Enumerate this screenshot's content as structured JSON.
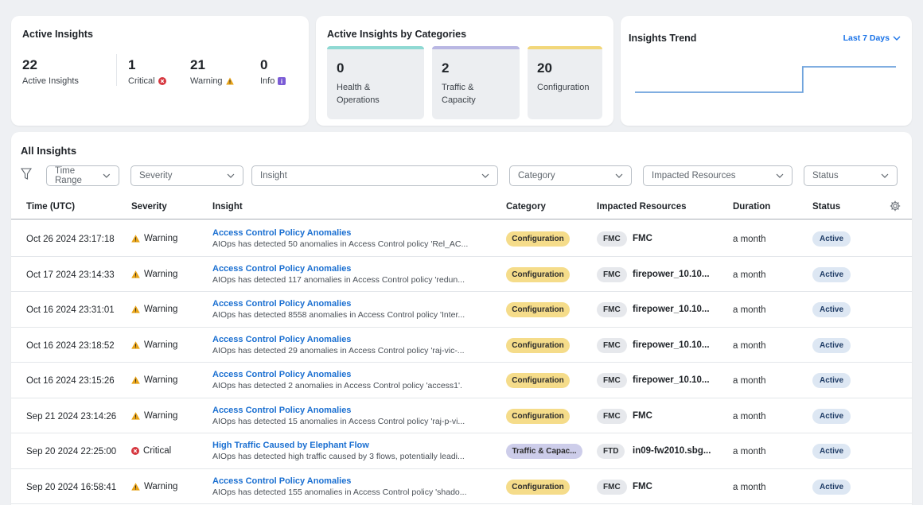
{
  "active_insights": {
    "title": "Active Insights",
    "total": {
      "value": "22",
      "label": "Active Insights"
    },
    "critical": {
      "value": "1",
      "label": "Critical"
    },
    "warning": {
      "value": "21",
      "label": "Warning"
    },
    "info": {
      "value": "0",
      "label": "Info"
    }
  },
  "categories_card": {
    "title": "Active Insights by Categories",
    "items": [
      {
        "value": "0",
        "label": "Health & Operations",
        "color": "#8fd9d3"
      },
      {
        "value": "2",
        "label": "Traffic & Capacity",
        "color": "#b9b7e3"
      },
      {
        "value": "20",
        "label": "Configuration",
        "color": "#f2d77a"
      }
    ]
  },
  "trend_card": {
    "title": "Insights Trend",
    "range_label": "Last 7 Days",
    "line_color": "#6fa3dd",
    "step_values": [
      1,
      1,
      1,
      1,
      1,
      2,
      2,
      2
    ]
  },
  "all_insights": {
    "title": "All Insights",
    "filters": {
      "time_range": "Time Range",
      "severity": "Severity",
      "insight": "Insight",
      "category": "Category",
      "impacted_resources": "Impacted Resources",
      "status": "Status"
    },
    "columns": {
      "time": "Time (UTC)",
      "severity": "Severity",
      "insight": "Insight",
      "category": "Category",
      "impacted_resources": "Impacted Resources",
      "duration": "Duration",
      "status": "Status"
    },
    "rows": [
      {
        "time": "Oct 26 2024 23:17:18",
        "severity": "Warning",
        "title": "Access Control Policy Anomalies",
        "desc": "AIOps has detected 50 anomalies in Access Control policy 'Rel_AC...",
        "category": "Configuration",
        "res_type": "FMC",
        "resource": "FMC",
        "duration": "a month",
        "status": "Active"
      },
      {
        "time": "Oct 17 2024 23:14:33",
        "severity": "Warning",
        "title": "Access Control Policy Anomalies",
        "desc": "AIOps has detected 117 anomalies in Access Control policy 'redun...",
        "category": "Configuration",
        "res_type": "FMC",
        "resource": "firepower_10.10...",
        "duration": "a month",
        "status": "Active"
      },
      {
        "time": "Oct 16 2024 23:31:01",
        "severity": "Warning",
        "title": "Access Control Policy Anomalies",
        "desc": "AIOps has detected 8558 anomalies in Access Control policy 'Inter...",
        "category": "Configuration",
        "res_type": "FMC",
        "resource": "firepower_10.10...",
        "duration": "a month",
        "status": "Active"
      },
      {
        "time": "Oct 16 2024 23:18:52",
        "severity": "Warning",
        "title": "Access Control Policy Anomalies",
        "desc": "AIOps has detected 29 anomalies in Access Control policy 'raj-vic-...",
        "category": "Configuration",
        "res_type": "FMC",
        "resource": "firepower_10.10...",
        "duration": "a month",
        "status": "Active"
      },
      {
        "time": "Oct 16 2024 23:15:26",
        "severity": "Warning",
        "title": "Access Control Policy Anomalies",
        "desc": "AIOps has detected 2 anomalies in Access Control policy 'access1'.",
        "category": "Configuration",
        "res_type": "FMC",
        "resource": "firepower_10.10...",
        "duration": "a month",
        "status": "Active"
      },
      {
        "time": "Sep 21 2024 23:14:26",
        "severity": "Warning",
        "title": "Access Control Policy Anomalies",
        "desc": "AIOps has detected 15 anomalies in Access Control policy 'raj-p-vi...",
        "category": "Configuration",
        "res_type": "FMC",
        "resource": "FMC",
        "duration": "a month",
        "status": "Active"
      },
      {
        "time": "Sep 20 2024 22:25:00",
        "severity": "Critical",
        "title": "High Traffic Caused by Elephant Flow",
        "desc": "AIOps has detected high traffic caused by 3 flows, potentially leadi...",
        "category": "Traffic & Capac...",
        "res_type": "FTD",
        "resource": "in09-fw2010.sbg...",
        "duration": "a month",
        "status": "Active"
      },
      {
        "time": "Sep 20 2024 16:58:41",
        "severity": "Warning",
        "title": "Access Control Policy Anomalies",
        "desc": "AIOps has detected 155 anomalies in Access Control policy 'shado...",
        "category": "Configuration",
        "res_type": "FMC",
        "resource": "FMC",
        "duration": "a month",
        "status": "Active"
      }
    ]
  },
  "colors": {
    "warning": "#e8a317",
    "critical": "#d6373f",
    "info": "#7b5cd6",
    "link": "#1a6fd1"
  }
}
